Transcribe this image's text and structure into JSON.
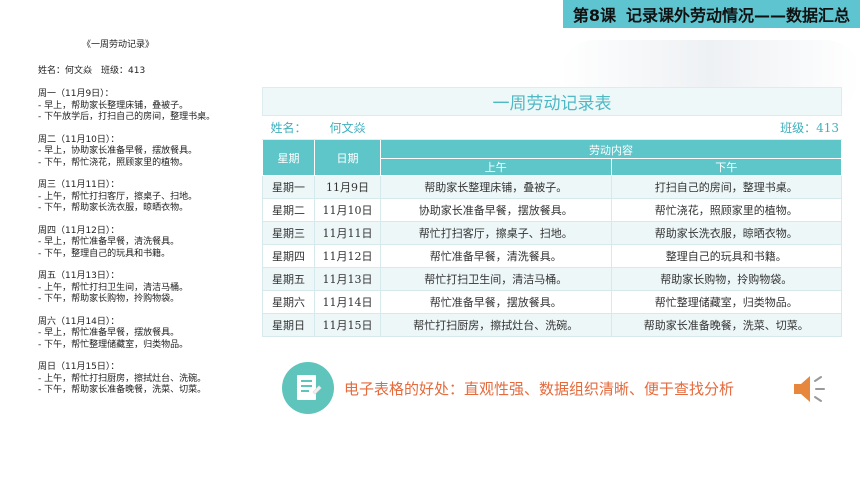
{
  "header": {
    "lesson_number": "第8课",
    "lesson_title": "记录课外劳动情况——数据汇总"
  },
  "record_doc": {
    "title": "《一周劳动记录》",
    "meta": "姓名：何文焱　班级：413",
    "days": [
      {
        "heading": "周一（11月9日）：",
        "lines": [
          "- 早上，帮助家长整理床铺，叠被子。",
          "- 下午放学后，打扫自己的房间，整理书桌。"
        ]
      },
      {
        "heading": "周二（11月10日）：",
        "lines": [
          "- 早上，协助家长准备早餐，摆放餐具。",
          "- 下午，帮忙浇花，照顾家里的植物。"
        ]
      },
      {
        "heading": "周三（11月11日）：",
        "lines": [
          "- 上午，帮忙打扫客厅，擦桌子、扫地。",
          "- 下午，帮助家长洗衣服，晾晒衣物。"
        ]
      },
      {
        "heading": "周四（11月12日）：",
        "lines": [
          "- 早上，帮忙准备早餐，清洗餐具。",
          "- 下午，整理自己的玩具和书籍。"
        ]
      },
      {
        "heading": "周五（11月13日）：",
        "lines": [
          "- 上午，帮忙打扫卫生间，清洁马桶。",
          "- 下午，帮助家长购物，拎购物袋。"
        ]
      },
      {
        "heading": "周六（11月14日）：",
        "lines": [
          "- 早上，帮忙准备早餐，摆放餐具。",
          "- 下午，帮忙整理储藏室，归类物品。"
        ]
      },
      {
        "heading": "周日（11月15日）：",
        "lines": [
          "- 上午，帮忙打扫厨房，擦拭灶台、洗碗。",
          "- 下午，帮助家长准备晚餐，洗菜、切菜。"
        ]
      }
    ]
  },
  "sheet": {
    "caption": "一周劳动记录表",
    "name_label": "姓名：",
    "name_value": "何文焱",
    "class_text": "班级：413",
    "headers": {
      "weekday": "星期",
      "date": "日期",
      "content": "劳动内容",
      "morning": "上午",
      "afternoon": "下午"
    },
    "rows": [
      {
        "weekday": "星期一",
        "date": "11月9日",
        "morning": "帮助家长整理床铺，叠被子。",
        "afternoon": "打扫自己的房间，整理书桌。"
      },
      {
        "weekday": "星期二",
        "date": "11月10日",
        "morning": "协助家长准备早餐，摆放餐具。",
        "afternoon": "帮忙浇花，照顾家里的植物。"
      },
      {
        "weekday": "星期三",
        "date": "11月11日",
        "morning": "帮忙打扫客厅，擦桌子、扫地。",
        "afternoon": "帮助家长洗衣服，晾晒衣物。"
      },
      {
        "weekday": "星期四",
        "date": "11月12日",
        "morning": "帮忙准备早餐，清洗餐具。",
        "afternoon": "整理自己的玩具和书籍。"
      },
      {
        "weekday": "星期五",
        "date": "11月13日",
        "morning": "帮忙打扫卫生间，清洁马桶。",
        "afternoon": "帮助家长购物，拎购物袋。"
      },
      {
        "weekday": "星期六",
        "date": "11月14日",
        "morning": "帮忙准备早餐，摆放餐具。",
        "afternoon": "帮忙整理储藏室，归类物品。"
      },
      {
        "weekday": "星期日",
        "date": "11月15日",
        "morning": "帮忙打扫厨房，擦拭灶台、洗碗。",
        "afternoon": "帮助家长准备晚餐，洗菜、切菜。"
      }
    ]
  },
  "benefit": {
    "text": "电子表格的好处：直观性强、数据组织清晰、便于查找分析",
    "icon": "document-icon",
    "speaker_icon": "speaker-icon"
  },
  "colors": {
    "accent": "#5ec4cf",
    "header_fill": "#5ec5c9",
    "highlight_text": "#e56a3c"
  }
}
